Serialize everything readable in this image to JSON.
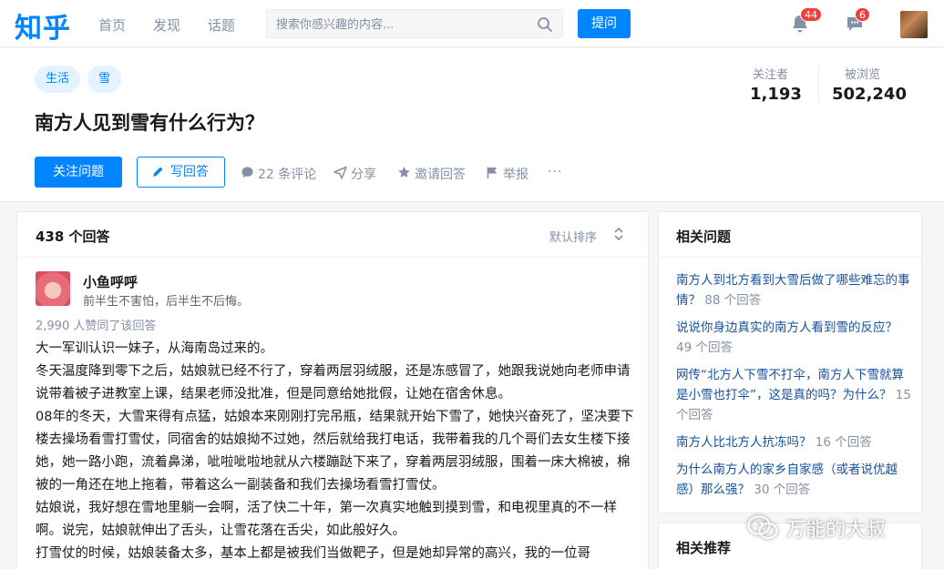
{
  "nav": {
    "logo": "知乎",
    "links": [
      "首页",
      "发现",
      "话题"
    ],
    "search_placeholder": "搜索你感兴趣的内容...",
    "ask_label": "提问",
    "notifications_count": "44",
    "messages_count": "6"
  },
  "question": {
    "tags": [
      "生活",
      "雪"
    ],
    "title": "南方人见到雪有什么行为？",
    "followers_label": "关注者",
    "followers_value": "1,193",
    "views_label": "被浏览",
    "views_value": "502,240",
    "follow_label": "关注问题",
    "write_label": "写回答",
    "actions": {
      "comments": "22 条评论",
      "share": "分享",
      "invite": "邀请回答",
      "report": "举报",
      "more": "···"
    }
  },
  "answers": {
    "count_label": "438 个回答",
    "sort_label": "默认排序",
    "author_name": "小鱼呼呼",
    "author_bio": "前半生不害怕，后半生不后悔。",
    "votes": "2,990 人赞同了该回答",
    "paragraphs": [
      "大一军训认识一妹子，从海南岛过来的。",
      "冬天温度降到零下之后，姑娘就已经不行了，穿着两层羽绒服，还是冻感冒了，她跟我说她向老师申请说带着被子进教室上课，结果老师没批准，但是同意给她批假，让她在宿舍休息。",
      "08年的冬天，大雪来得有点猛，姑娘本来刚刚打完吊瓶，结果就开始下雪了，她快兴奋死了，坚决要下楼去操场看雪打雪仗，同宿舍的姑娘拗不过她，然后就给我打电话，我带着我的几个哥们去女生楼下接她，她一路小跑，流着鼻涕，呲啦呲啦地就从六楼蹦跶下来了，穿着两层羽绒服，围着一床大棉被，棉被的一角还在地上拖着，带着这么一副装备和我们去操场看雪打雪仗。",
      "姑娘说，我好想在雪地里躺一会啊，活了快二十年，第一次真实地触到摸到雪，和电视里真的不一样啊。说完，姑娘就伸出了舌头，让雪花落在舌尖，如此般好久。",
      "打雪仗的时候，姑娘装备太多，基本上都是被我们当做靶子，但是她却异常的高兴，我的一位哥"
    ]
  },
  "sidebar": {
    "related_title": "相关问题",
    "related": [
      {
        "text": "南方人到北方看到大雪后做了哪些难忘的事情？",
        "count": "88 个回答"
      },
      {
        "text": "说说你身边真实的南方人看到雪的反应？",
        "count": "49 个回答"
      },
      {
        "text": "网传“北方人下雪不打伞，南方人下雪就算是小雪也打伞”，这是真的吗？为什么？",
        "count": "15 个回答"
      },
      {
        "text": "南方人比北方人抗冻吗？",
        "count": "16 个回答"
      },
      {
        "text": "为什么南方人的家乡自家感（或者说优越感）那么强？",
        "count": "30 个回答"
      }
    ],
    "recommend_title": "相关推荐"
  },
  "watermark": "万能的大叔",
  "colors": {
    "brand": "#0084ff",
    "link": "#175199",
    "muted": "#8590a6",
    "badge": "#f1403c"
  }
}
